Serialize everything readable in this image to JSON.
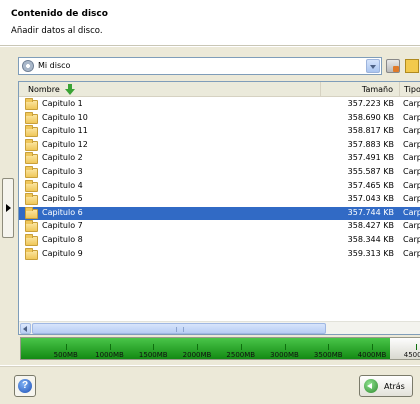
{
  "header": {
    "title": "Contenido de disco",
    "subtitle": "Añadir datos al disco."
  },
  "location": {
    "value": "Mi disco",
    "icon": "disk-icon"
  },
  "toolbar": {
    "icons": [
      "disk-action-icon",
      "new-folder-icon"
    ]
  },
  "columns": {
    "name": "Nombre",
    "size": "Tamaño",
    "type": "Tipo"
  },
  "rows": [
    {
      "name": "Capitulo 1",
      "size": "357.223 KB",
      "type": "Carp"
    },
    {
      "name": "Capitulo 10",
      "size": "358.690 KB",
      "type": "Carp"
    },
    {
      "name": "Capitulo 11",
      "size": "358.817 KB",
      "type": "Carp"
    },
    {
      "name": "Capitulo 12",
      "size": "357.883 KB",
      "type": "Carp"
    },
    {
      "name": "Capitulo 2",
      "size": "357.491 KB",
      "type": "Carp"
    },
    {
      "name": "Capitulo 3",
      "size": "355.587 KB",
      "type": "Carp"
    },
    {
      "name": "Capitulo 4",
      "size": "357.465 KB",
      "type": "Carp"
    },
    {
      "name": "Capitulo 5",
      "size": "357.043 KB",
      "type": "Carp"
    },
    {
      "name": "Capitulo 6",
      "size": "357.744 KB",
      "type": "Carp"
    },
    {
      "name": "Capitulo 7",
      "size": "358.427 KB",
      "type": "Carp"
    },
    {
      "name": "Capitulo 8",
      "size": "358.344 KB",
      "type": "Carp"
    },
    {
      "name": "Capitulo 9",
      "size": "359.313 KB",
      "type": "Carp"
    }
  ],
  "selected_row": 8,
  "capacity": {
    "ticks": [
      "500MB",
      "1000MB",
      "1500MB",
      "2000MB",
      "2500MB",
      "3000MB",
      "3500MB",
      "4000MB",
      "4500"
    ],
    "tick_values_mb": [
      500,
      1000,
      1500,
      2000,
      2500,
      3000,
      3500,
      4000,
      4500
    ],
    "used_mb": 4200,
    "colors": {
      "used": "#2fb82f",
      "empty": "#f4f4ee"
    }
  },
  "footer": {
    "help_label": "?",
    "back_label": "Atrás"
  },
  "colors": {
    "selection": "#316ac5",
    "panel": "#ece9d8",
    "border": "#7f9db9"
  }
}
